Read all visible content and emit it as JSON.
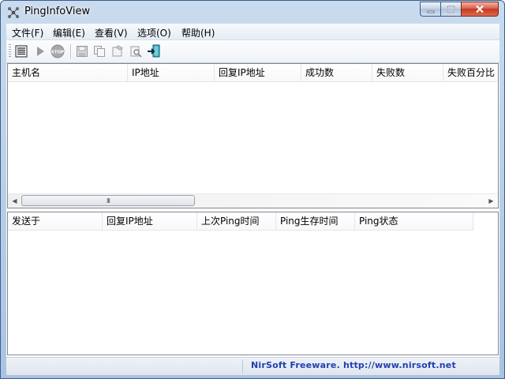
{
  "window": {
    "title": "PingInfoView",
    "controls": {
      "minimize": "minimize",
      "maximize": "maximize",
      "close": "close"
    }
  },
  "menu": {
    "items": [
      {
        "label": "文件(F)"
      },
      {
        "label": "编辑(E)"
      },
      {
        "label": "查看(V)"
      },
      {
        "label": "选项(O)"
      },
      {
        "label": "帮助(H)"
      }
    ]
  },
  "toolbar": {
    "buttons": [
      {
        "name": "properties-list-icon"
      },
      {
        "name": "start-play-icon"
      },
      {
        "name": "stop-icon"
      },
      {
        "name": "save-icon"
      },
      {
        "name": "copy-icon"
      },
      {
        "name": "html-report-icon"
      },
      {
        "name": "find-icon"
      },
      {
        "name": "exit-icon"
      }
    ]
  },
  "top_table": {
    "columns": [
      "主机名",
      "IP地址",
      "回复IP地址",
      "成功数",
      "失败数",
      "失败百分比"
    ],
    "rows": []
  },
  "bottom_table": {
    "columns": [
      "发送于",
      "回复IP地址",
      "上次Ping时间",
      "Ping生存时间",
      "Ping状态"
    ],
    "rows": []
  },
  "scrollbar": {
    "thumb_grip": "III"
  },
  "status": {
    "link_text": "NirSoft Freeware.  http://www.nirsoft.net"
  },
  "colors": {
    "link": "#1f3fb4",
    "title_bar": "#c9dbef",
    "close_button": "#c5391f"
  }
}
